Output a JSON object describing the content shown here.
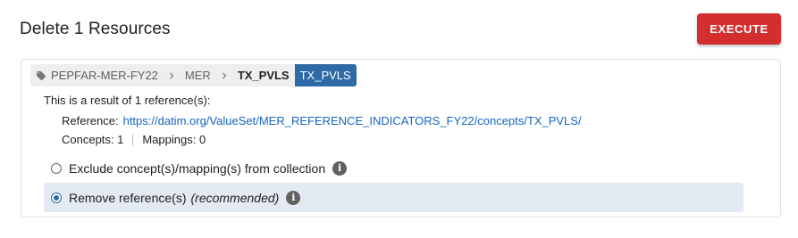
{
  "header": {
    "title": "Delete 1 Resources",
    "execute_label": "EXECUTE"
  },
  "breadcrumb": {
    "owner": "PEPFAR-MER-FY22",
    "collection": "MER",
    "concept": "TX_PVLS",
    "badge": "TX_PVLS",
    "icons": [
      "tag-icon",
      "chevron-right-icon"
    ]
  },
  "result": {
    "summary": "This is a result of 1 reference(s):",
    "reference_label": "Reference:",
    "reference_url": "https://datim.org/ValueSet/MER_REFERENCE_INDICATORS_FY22/concepts/TX_PVLS/",
    "concepts_text": "Concepts: 1",
    "mappings_text": "Mappings: 0"
  },
  "options": {
    "exclude_label": "Exclude concept(s)/mapping(s) from collection",
    "remove_label": "Remove reference(s)",
    "remove_hint": "(recommended)",
    "selected": "remove"
  },
  "colors": {
    "execute": "#d32f2f",
    "badge": "#2d6aa6",
    "link": "#1565c0",
    "selected_option_bg": "#e3eaf3"
  }
}
